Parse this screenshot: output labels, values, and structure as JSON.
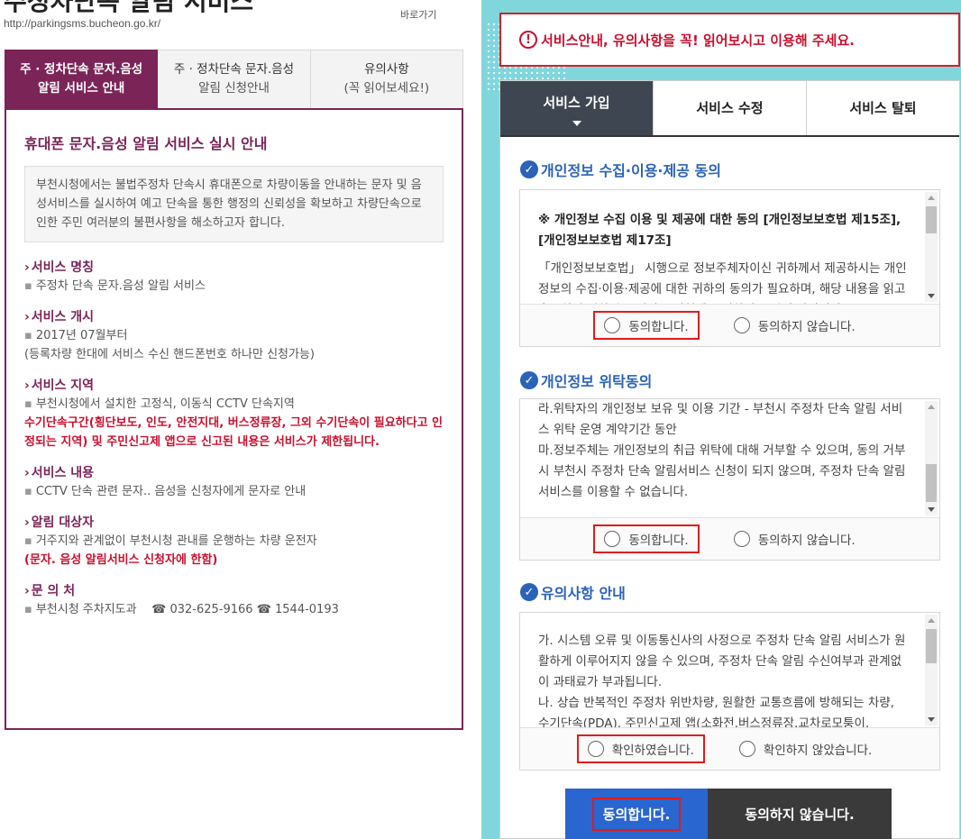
{
  "header": {
    "title": "주정차단속 알림 서비스",
    "goto": "바로가기",
    "url": "http://parkingsms.bucheon.go.kr/"
  },
  "left_tabs": [
    {
      "line1": "주 · 정차단속 문자.음성",
      "line2": "알림 서비스 안내"
    },
    {
      "line1": "주 · 정차단속 문자.음성",
      "line2": "알림 신청안내"
    },
    {
      "line1": "유의사항",
      "line2": "(꼭 읽어보세요!)"
    }
  ],
  "content": {
    "title": "휴대폰 문자.음성 알림 서비스 실시 안내",
    "intro": "부천시청에서는 불법주정차 단속시 휴대폰으로 차량이동을 안내하는 문자 및 음성서비스를 실시하여 예고 단속을 통한 행정의 신뢰성을 확보하고 차량단속으로 인한 주민 여러분의 불편사항을 해소하고자 합니다.",
    "s1_h": "서비스 명칭",
    "s1_t": "주정차 단속 문자.음성 알림 서비스",
    "s2_h": "서비스 개시",
    "s2_t1": "2017년 07월부터",
    "s2_t2": "(등록차량 한대에 서비스 수신 핸드폰번호 하나만 신청가능)",
    "s3_h": "서비스 지역",
    "s3_t": "부천시청에서 설치한 고정식, 이동식 CCTV 단속지역",
    "s3_red": "수기단속구간(횡단보도, 인도, 안전지대, 버스정류장, 그외 수기단속이 필요하다고 인정되는 지역) 및 주민신고제 앱으로 신고된 내용은 서비스가 제한됩니다.",
    "s4_h": "서비스 내용",
    "s4_t": "CCTV 단속 관련 문자.. 음성을 신청자에게 문자로 안내",
    "s5_h": "알림 대상자",
    "s5_t": "거주지와 관계없이 부천시청 관내를 운행하는 차량 운전자",
    "s5_red": "(문자. 음성 알림서비스 신청자에 한함)",
    "s6_h": "문 의 처",
    "s6_t": "부천시청 주차지도과",
    "s6_p1": "☎ 032-625-9166",
    "s6_p2": "☎ 1544-0193"
  },
  "notice": "서비스안내, 유의사항을 꼭! 읽어보시고 이용해 주세요.",
  "right_tabs": [
    "서비스 가입",
    "서비스 수정",
    "서비스 탈퇴"
  ],
  "block1": {
    "title": "개인정보 수집·이용·제공 동의",
    "bold": "※ 개인정보 수집 이용 및 제공에 대한 동의 [개인정보보호법 제15조], [개인정보보호법 제17조]",
    "text": "「개인정보보호법」 시행으로 정보주체자이신 귀하께서 제공하시는 개인정보의 수집·이용·제공에 대한 귀하의 동의가 필요하며, 해당 내용을 읽고 충분히 숙지하시고 서비스 신청에 동의하여 주시기 바랍니다.",
    "agree": "동의합니다.",
    "disagree": "동의하지 않습니다."
  },
  "block2": {
    "title": "개인정보 위탁동의",
    "text": "라.위탁자의 개인정보 보유 및 이용 기간 - 부천시 주정차 단속 알림 서비스 위탁 운영 계약기간 동안\n마.정보주체는 개인정보의 취급 위탁에 대해 거부할 수 있으며, 동의 거부 시 부천시 주정차 단속 알림서비스 신청이 되지 않으며, 주정차 단속 알림서비스를 이용할 수 없습니다.",
    "agree": "동의합니다.",
    "disagree": "동의하지 않습니다."
  },
  "block3": {
    "title": "유의사항 안내",
    "text": "가. 시스템 오류 및 이동통신사의 사정으로 주정차 단속 알림 서비스가 원활하게 이루어지지 않을 수 있으며, 주정차 단속 알림 수신여부과 관계없이 과태료가 부과됩니다.\n나. 상습 반복적인 주정차 위반차량, 원활한 교통흐름에 방해되는 차량, 수기단속(PDA), 주민신고제 앱(소화전,버스정류장,교차로모퉁이,",
    "agree": "확인하였습니다.",
    "disagree": "확인하지 않았습니다."
  },
  "buttons": {
    "agree": "동의합니다.",
    "disagree": "동의하지 않습니다."
  }
}
